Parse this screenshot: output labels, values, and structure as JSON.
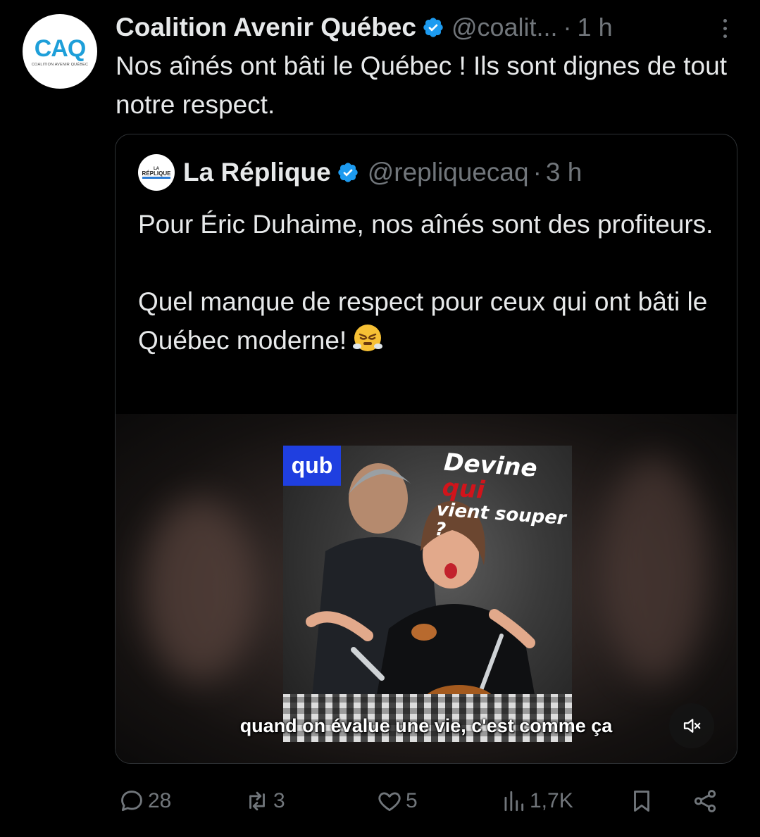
{
  "post": {
    "author_name": "Coalition Avenir Québec",
    "handle": "@coalit...",
    "separator": "·",
    "time": "1 h",
    "text": "Nos aînés ont bâti le Québec ! Ils sont dignes de tout notre respect.",
    "avatar": {
      "logo_text": "CAQ",
      "logo_subtext": "COALITION AVENIR QUÉBEC"
    }
  },
  "quote": {
    "author_name": "La Réplique",
    "handle": "@repliquecaq",
    "separator": "·",
    "time": "3 h",
    "avatar": {
      "line1": "LA",
      "line2": "RÉPLIQUE"
    },
    "paragraph1": "Pour Éric Duhaime, nos aînés sont des profiteurs.",
    "paragraph2": "Quel manque de respect pour ceux qui ont bâti le Québec moderne!",
    "emoji": "face-with-steam-from-nose",
    "media": {
      "badge": "qub",
      "title_line1_a": "Devine ",
      "title_line1_b": "qui",
      "title_line2": "vient souper ?",
      "subtitle": "quand on évalue une vie, c'est comme ça",
      "mute_icon": "speaker-muted-icon"
    }
  },
  "actions": {
    "replies": "28",
    "reposts": "3",
    "likes": "5",
    "views": "1,7K"
  },
  "colors": {
    "background": "#000000",
    "text": "#e7e9ea",
    "muted": "#71767b",
    "verified": "#1d9bf0",
    "border": "#2f3336",
    "qub_blue": "#1f3fe0",
    "poster_red": "#d1141b"
  }
}
